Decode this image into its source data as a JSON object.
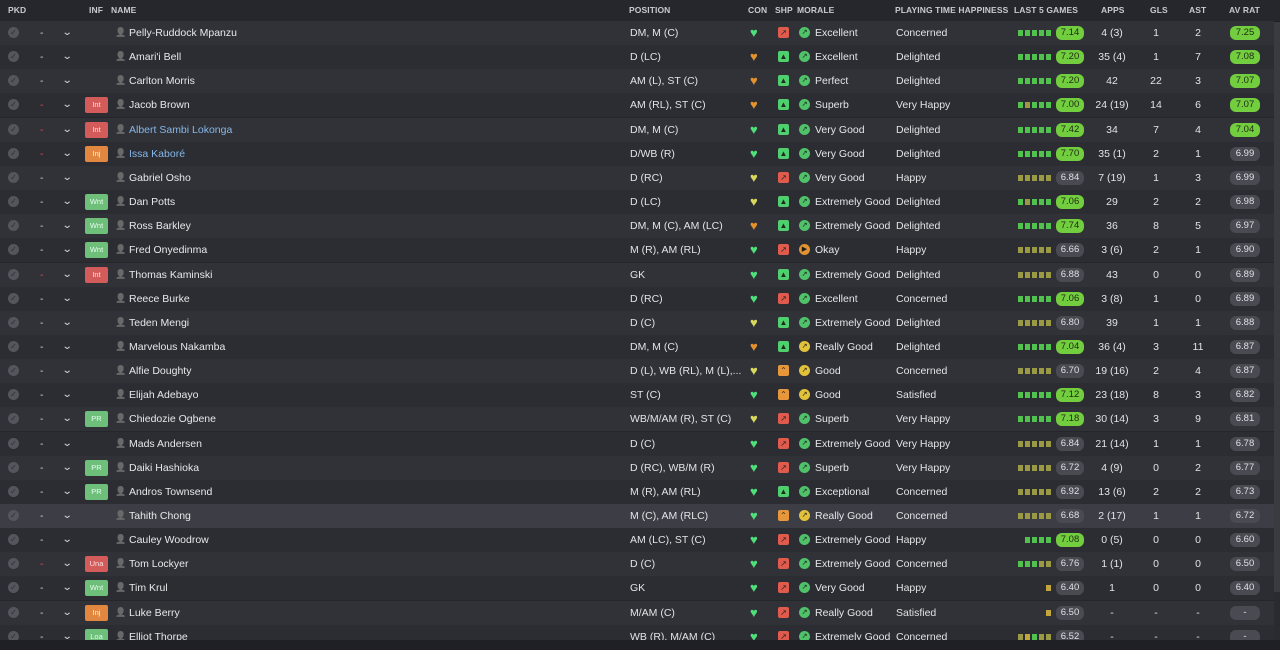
{
  "headers": {
    "pkd": "PKD",
    "inf": "INF",
    "name": "NAME",
    "position": "POSITION",
    "con": "CON",
    "shp": "SHP",
    "morale": "MORALE",
    "playing_time_happiness": "PLAYING TIME HAPPINESS",
    "last5": "LAST 5 GAMES",
    "apps": "APPS",
    "gls": "GLS",
    "ast": "AST",
    "avrat": "AV RAT"
  },
  "icons": {
    "pkd": "pick-toggle-icon",
    "chevron": "chevron-down-icon",
    "person": "person-icon",
    "condition": "heart-icon",
    "sharpness": "sharpness-icon",
    "morale": "morale-icon"
  },
  "colors": {
    "cond_green": "#4fe07a",
    "cond_yellow": "#d7d85c",
    "cond_orange": "#e4922f",
    "shp_red": "#e05a4e",
    "shp_green": "#4fcf6e",
    "shp_orange": "#e7963a",
    "mor_green": "#4fc26a",
    "mor_yellow": "#e1c23a",
    "mor_orange": "#e29332",
    "form_green": "#52c24f",
    "form_olive": "#9a9a44",
    "form_yellow": "#c2a63d",
    "rating_high": "#72cd3f",
    "rating_normal": "#4a4b52",
    "inf_red": "#d35b59",
    "inf_orange": "#e2873f",
    "inf_green": "#6dbf7a",
    "link_name": "#86b7e8"
  },
  "players": [
    {
      "role": "-",
      "role_red": false,
      "inf": "",
      "name": "Pelly-Ruddock Mpanzu",
      "link": false,
      "position": "DM, M (C)",
      "cond": "green",
      "shp": "red",
      "mor": "green",
      "morale": "Excellent",
      "pth": "Concerned",
      "form": [
        "g",
        "g",
        "g",
        "g",
        "g"
      ],
      "last5": "7.14",
      "last5_high": true,
      "apps": "4 (3)",
      "gls": "1",
      "ast": "2",
      "avrat": "7.25",
      "avrat_high": true
    },
    {
      "role": "-",
      "role_red": false,
      "inf": "",
      "name": "Amari'i Bell",
      "link": false,
      "position": "D (LC)",
      "cond": "orange",
      "shp": "green",
      "mor": "green",
      "morale": "Excellent",
      "pth": "Delighted",
      "form": [
        "g",
        "g",
        "g",
        "g",
        "g"
      ],
      "last5": "7.20",
      "last5_high": true,
      "apps": "35 (4)",
      "gls": "1",
      "ast": "7",
      "avrat": "7.08",
      "avrat_high": true
    },
    {
      "role": "-",
      "role_red": false,
      "inf": "",
      "name": "Carlton Morris",
      "link": false,
      "position": "AM (L), ST (C)",
      "cond": "orange",
      "shp": "green",
      "mor": "green",
      "morale": "Perfect",
      "pth": "Delighted",
      "form": [
        "g",
        "g",
        "g",
        "g",
        "g"
      ],
      "last5": "7.20",
      "last5_high": true,
      "apps": "42",
      "gls": "22",
      "ast": "3",
      "avrat": "7.07",
      "avrat_high": true
    },
    {
      "role": "-",
      "role_red": true,
      "inf": "Int",
      "name": "Jacob Brown",
      "link": false,
      "position": "AM (RL), ST (C)",
      "cond": "orange",
      "shp": "green",
      "mor": "green",
      "morale": "Superb",
      "pth": "Very Happy",
      "form": [
        "g",
        "o",
        "g",
        "g",
        "g"
      ],
      "last5": "7.00",
      "last5_high": true,
      "apps": "24 (19)",
      "gls": "14",
      "ast": "6",
      "avrat": "7.07",
      "avrat_high": true
    },
    {
      "role": "-",
      "role_red": true,
      "inf": "Int",
      "name": "Albert Sambi Lokonga",
      "link": true,
      "position": "DM, M (C)",
      "cond": "green",
      "shp": "green",
      "mor": "green",
      "morale": "Very Good",
      "pth": "Delighted",
      "form": [
        "g",
        "g",
        "g",
        "g",
        "g"
      ],
      "last5": "7.42",
      "last5_high": true,
      "apps": "34",
      "gls": "7",
      "ast": "4",
      "avrat": "7.04",
      "avrat_high": true
    },
    {
      "role": "-",
      "role_red": true,
      "inf": "Inj",
      "name": "Issa Kaboré",
      "link": true,
      "position": "D/WB (R)",
      "cond": "green",
      "shp": "green",
      "mor": "green",
      "morale": "Very Good",
      "pth": "Delighted",
      "form": [
        "g",
        "g",
        "g",
        "g",
        "g"
      ],
      "last5": "7.70",
      "last5_high": true,
      "apps": "35 (1)",
      "gls": "2",
      "ast": "1",
      "avrat": "6.99",
      "avrat_high": false
    },
    {
      "role": "-",
      "role_red": false,
      "inf": "",
      "name": "Gabriel Osho",
      "link": false,
      "position": "D (RC)",
      "cond": "yellow",
      "shp": "red",
      "mor": "green",
      "morale": "Very Good",
      "pth": "Happy",
      "form": [
        "o",
        "o",
        "o",
        "o",
        "o"
      ],
      "last5": "6.84",
      "last5_high": false,
      "apps": "7 (19)",
      "gls": "1",
      "ast": "3",
      "avrat": "6.99",
      "avrat_high": false
    },
    {
      "role": "-",
      "role_red": false,
      "inf": "Wnt",
      "name": "Dan Potts",
      "link": false,
      "position": "D (LC)",
      "cond": "yellow",
      "shp": "green",
      "mor": "green",
      "morale": "Extremely Good",
      "pth": "Delighted",
      "form": [
        "g",
        "o",
        "g",
        "g",
        "g"
      ],
      "last5": "7.06",
      "last5_high": true,
      "apps": "29",
      "gls": "2",
      "ast": "2",
      "avrat": "6.98",
      "avrat_high": false
    },
    {
      "role": "-",
      "role_red": false,
      "inf": "Wnt",
      "name": "Ross Barkley",
      "link": false,
      "position": "DM, M (C), AM (LC)",
      "cond": "orange",
      "shp": "green",
      "mor": "green",
      "morale": "Extremely Good",
      "pth": "Delighted",
      "form": [
        "g",
        "g",
        "g",
        "g",
        "g"
      ],
      "last5": "7.74",
      "last5_high": true,
      "apps": "36",
      "gls": "8",
      "ast": "5",
      "avrat": "6.97",
      "avrat_high": false
    },
    {
      "role": "-",
      "role_red": false,
      "inf": "Wnt",
      "name": "Fred Onyedinma",
      "link": false,
      "position": "M (R), AM (RL)",
      "cond": "green",
      "shp": "red",
      "mor": "orange",
      "morale": "Okay",
      "pth": "Happy",
      "form": [
        "o",
        "o",
        "o",
        "o",
        "o"
      ],
      "last5": "6.66",
      "last5_high": false,
      "apps": "3 (6)",
      "gls": "2",
      "ast": "1",
      "avrat": "6.90",
      "avrat_high": false
    },
    {
      "role": "-",
      "role_red": true,
      "inf": "Int",
      "name": "Thomas Kaminski",
      "link": false,
      "position": "GK",
      "cond": "green",
      "shp": "green",
      "mor": "green",
      "morale": "Extremely Good",
      "pth": "Delighted",
      "form": [
        "o",
        "o",
        "o",
        "o",
        "o"
      ],
      "last5": "6.88",
      "last5_high": false,
      "apps": "43",
      "gls": "0",
      "ast": "0",
      "avrat": "6.89",
      "avrat_high": false
    },
    {
      "role": "-",
      "role_red": false,
      "inf": "",
      "name": "Reece Burke",
      "link": false,
      "position": "D (RC)",
      "cond": "green",
      "shp": "red",
      "mor": "green",
      "morale": "Excellent",
      "pth": "Concerned",
      "form": [
        "g",
        "g",
        "g",
        "g",
        "g"
      ],
      "last5": "7.06",
      "last5_high": true,
      "apps": "3 (8)",
      "gls": "1",
      "ast": "0",
      "avrat": "6.89",
      "avrat_high": false
    },
    {
      "role": "-",
      "role_red": false,
      "inf": "",
      "name": "Teden Mengi",
      "link": false,
      "position": "D (C)",
      "cond": "yellow",
      "shp": "green",
      "mor": "green",
      "morale": "Extremely Good",
      "pth": "Delighted",
      "form": [
        "o",
        "o",
        "o",
        "o",
        "o"
      ],
      "last5": "6.80",
      "last5_high": false,
      "apps": "39",
      "gls": "1",
      "ast": "1",
      "avrat": "6.88",
      "avrat_high": false
    },
    {
      "role": "-",
      "role_red": false,
      "inf": "",
      "name": "Marvelous Nakamba",
      "link": false,
      "position": "DM, M (C)",
      "cond": "orange",
      "shp": "green",
      "mor": "yellow",
      "morale": "Really Good",
      "pth": "Delighted",
      "form": [
        "g",
        "g",
        "g",
        "g",
        "g"
      ],
      "last5": "7.04",
      "last5_high": true,
      "apps": "36 (4)",
      "gls": "3",
      "ast": "11",
      "avrat": "6.87",
      "avrat_high": false
    },
    {
      "role": "-",
      "role_red": false,
      "inf": "",
      "name": "Alfie Doughty",
      "link": false,
      "position": "D (L), WB (RL), M (L),...",
      "cond": "yellow",
      "shp": "orange",
      "mor": "yellow",
      "morale": "Good",
      "pth": "Concerned",
      "form": [
        "o",
        "o",
        "o",
        "o",
        "o"
      ],
      "last5": "6.70",
      "last5_high": false,
      "apps": "19 (16)",
      "gls": "2",
      "ast": "4",
      "avrat": "6.87",
      "avrat_high": false
    },
    {
      "role": "-",
      "role_red": false,
      "inf": "",
      "name": "Elijah Adebayo",
      "link": false,
      "position": "ST (C)",
      "cond": "green",
      "shp": "orange",
      "mor": "yellow",
      "morale": "Good",
      "pth": "Satisfied",
      "form": [
        "g",
        "g",
        "g",
        "g",
        "g"
      ],
      "last5": "7.12",
      "last5_high": true,
      "apps": "23 (18)",
      "gls": "8",
      "ast": "3",
      "avrat": "6.82",
      "avrat_high": false
    },
    {
      "role": "-",
      "role_red": false,
      "inf": "PR",
      "name": "Chiedozie Ogbene",
      "link": false,
      "position": "WB/M/AM (R), ST (C)",
      "cond": "yellow",
      "shp": "red",
      "mor": "green",
      "morale": "Superb",
      "pth": "Very Happy",
      "form": [
        "g",
        "g",
        "g",
        "g",
        "g"
      ],
      "last5": "7.18",
      "last5_high": true,
      "apps": "30 (14)",
      "gls": "3",
      "ast": "9",
      "avrat": "6.81",
      "avrat_high": false
    },
    {
      "role": "-",
      "role_red": false,
      "inf": "",
      "name": "Mads Andersen",
      "link": false,
      "position": "D (C)",
      "cond": "green",
      "shp": "red",
      "mor": "green",
      "morale": "Extremely Good",
      "pth": "Very Happy",
      "form": [
        "o",
        "o",
        "o",
        "o",
        "o"
      ],
      "last5": "6.84",
      "last5_high": false,
      "apps": "21 (14)",
      "gls": "1",
      "ast": "1",
      "avrat": "6.78",
      "avrat_high": false
    },
    {
      "role": "-",
      "role_red": false,
      "inf": "PR",
      "name": "Daiki Hashioka",
      "link": false,
      "position": "D (RC), WB/M (R)",
      "cond": "green",
      "shp": "red",
      "mor": "green",
      "morale": "Superb",
      "pth": "Very Happy",
      "form": [
        "o",
        "o",
        "o",
        "o",
        "o"
      ],
      "last5": "6.72",
      "last5_high": false,
      "apps": "4 (9)",
      "gls": "0",
      "ast": "2",
      "avrat": "6.77",
      "avrat_high": false
    },
    {
      "role": "-",
      "role_red": false,
      "inf": "PR",
      "name": "Andros Townsend",
      "link": false,
      "position": "M (R), AM (RL)",
      "cond": "green",
      "shp": "green",
      "mor": "green",
      "morale": "Exceptional",
      "pth": "Concerned",
      "form": [
        "o",
        "o",
        "o",
        "o",
        "o"
      ],
      "last5": "6.92",
      "last5_high": false,
      "apps": "13 (6)",
      "gls": "2",
      "ast": "2",
      "avrat": "6.73",
      "avrat_high": false
    },
    {
      "role": "-",
      "role_red": false,
      "inf": "",
      "name": "Tahith Chong",
      "link": false,
      "position": "M (C), AM (RLC)",
      "cond": "green",
      "shp": "orange",
      "mor": "yellow",
      "morale": "Really Good",
      "pth": "Concerned",
      "form": [
        "o",
        "o",
        "o",
        "o",
        "o"
      ],
      "last5": "6.68",
      "last5_high": false,
      "apps": "2 (17)",
      "gls": "1",
      "ast": "1",
      "avrat": "6.72",
      "avrat_high": false,
      "highlight": true
    },
    {
      "role": "-",
      "role_red": false,
      "inf": "",
      "name": "Cauley Woodrow",
      "link": false,
      "position": "AM (LC), ST (C)",
      "cond": "green",
      "shp": "red",
      "mor": "green",
      "morale": "Extremely Good",
      "pth": "Happy",
      "form": [
        "g",
        "g",
        "g",
        "g"
      ],
      "last5": "7.08",
      "last5_high": true,
      "apps": "0 (5)",
      "gls": "0",
      "ast": "0",
      "avrat": "6.60",
      "avrat_high": false
    },
    {
      "role": "-",
      "role_red": true,
      "inf": "Una",
      "name": "Tom Lockyer",
      "link": false,
      "position": "D (C)",
      "cond": "green",
      "shp": "red",
      "mor": "green",
      "morale": "Extremely Good",
      "pth": "Concerned",
      "form": [
        "g",
        "g",
        "g",
        "o",
        "o"
      ],
      "last5": "6.76",
      "last5_high": false,
      "apps": "1 (1)",
      "gls": "0",
      "ast": "0",
      "avrat": "6.50",
      "avrat_high": false
    },
    {
      "role": "-",
      "role_red": false,
      "inf": "Wnt",
      "name": "Tim Krul",
      "link": false,
      "position": "GK",
      "cond": "green",
      "shp": "red",
      "mor": "green",
      "morale": "Very Good",
      "pth": "Happy",
      "form": [
        "y"
      ],
      "last5": "6.40",
      "last5_high": false,
      "apps": "1",
      "gls": "0",
      "ast": "0",
      "avrat": "6.40",
      "avrat_high": false
    },
    {
      "role": "-",
      "role_red": false,
      "inf": "Inj",
      "name": "Luke Berry",
      "link": false,
      "position": "M/AM (C)",
      "cond": "green",
      "shp": "red",
      "mor": "green",
      "morale": "Really Good",
      "pth": "Satisfied",
      "form": [
        "y"
      ],
      "last5": "6.50",
      "last5_high": false,
      "apps": "-",
      "gls": "-",
      "ast": "-",
      "avrat": "-",
      "avrat_high": false
    },
    {
      "role": "-",
      "role_red": false,
      "inf": "Loa",
      "name": "Elliot Thorpe",
      "link": false,
      "position": "WB (R), M/AM (C)",
      "cond": "green",
      "shp": "red",
      "mor": "green",
      "morale": "Extremely Good",
      "pth": "Concerned",
      "form": [
        "o",
        "y",
        "g",
        "o",
        "o"
      ],
      "last5": "6.52",
      "last5_high": false,
      "apps": "-",
      "gls": "-",
      "ast": "-",
      "avrat": "-",
      "avrat_high": false
    }
  ]
}
